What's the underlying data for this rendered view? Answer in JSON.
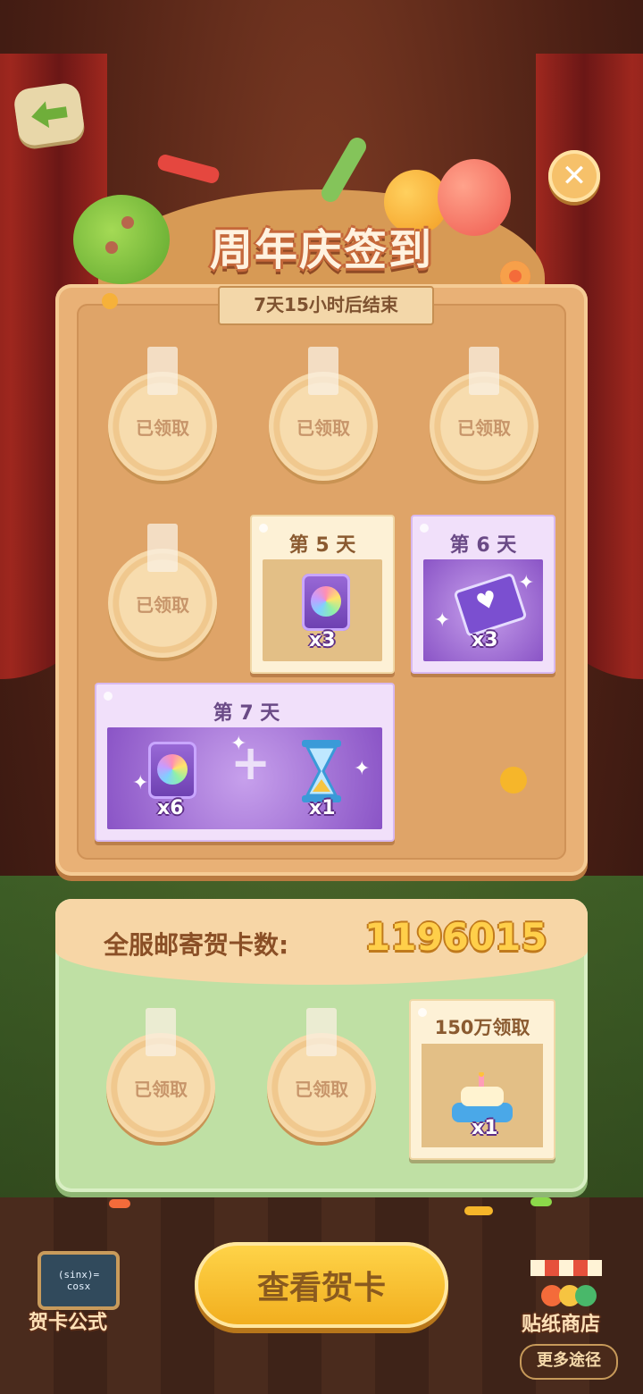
{
  "header": {
    "title": "周年庆签到",
    "timer_text": "7天15小时后结束"
  },
  "claimed_label": "已领取",
  "days": {
    "day5": {
      "label": "第 5 天",
      "qty": "x3"
    },
    "day6": {
      "label": "第 6 天",
      "qty": "x3"
    },
    "day7": {
      "label": "第 7 天",
      "qty_a": "x6",
      "qty_b": "x1"
    }
  },
  "mail": {
    "label": "全服邮寄贺卡数:",
    "count": "1196015",
    "reward_label": "150万领取",
    "reward_qty": "x1"
  },
  "footer": {
    "view_button": "查看贺卡",
    "formula_label": "贺卡公式",
    "formula_line1": "(sinx)=",
    "formula_line2": "cosx",
    "shop_label": "贴纸商店",
    "more_label": "更多途径"
  },
  "colors": {
    "board": "#e9b176",
    "panel_green": "#bfe0a4",
    "button_yellow": "#ffd54a",
    "count_gold": "#ffcf4a"
  }
}
